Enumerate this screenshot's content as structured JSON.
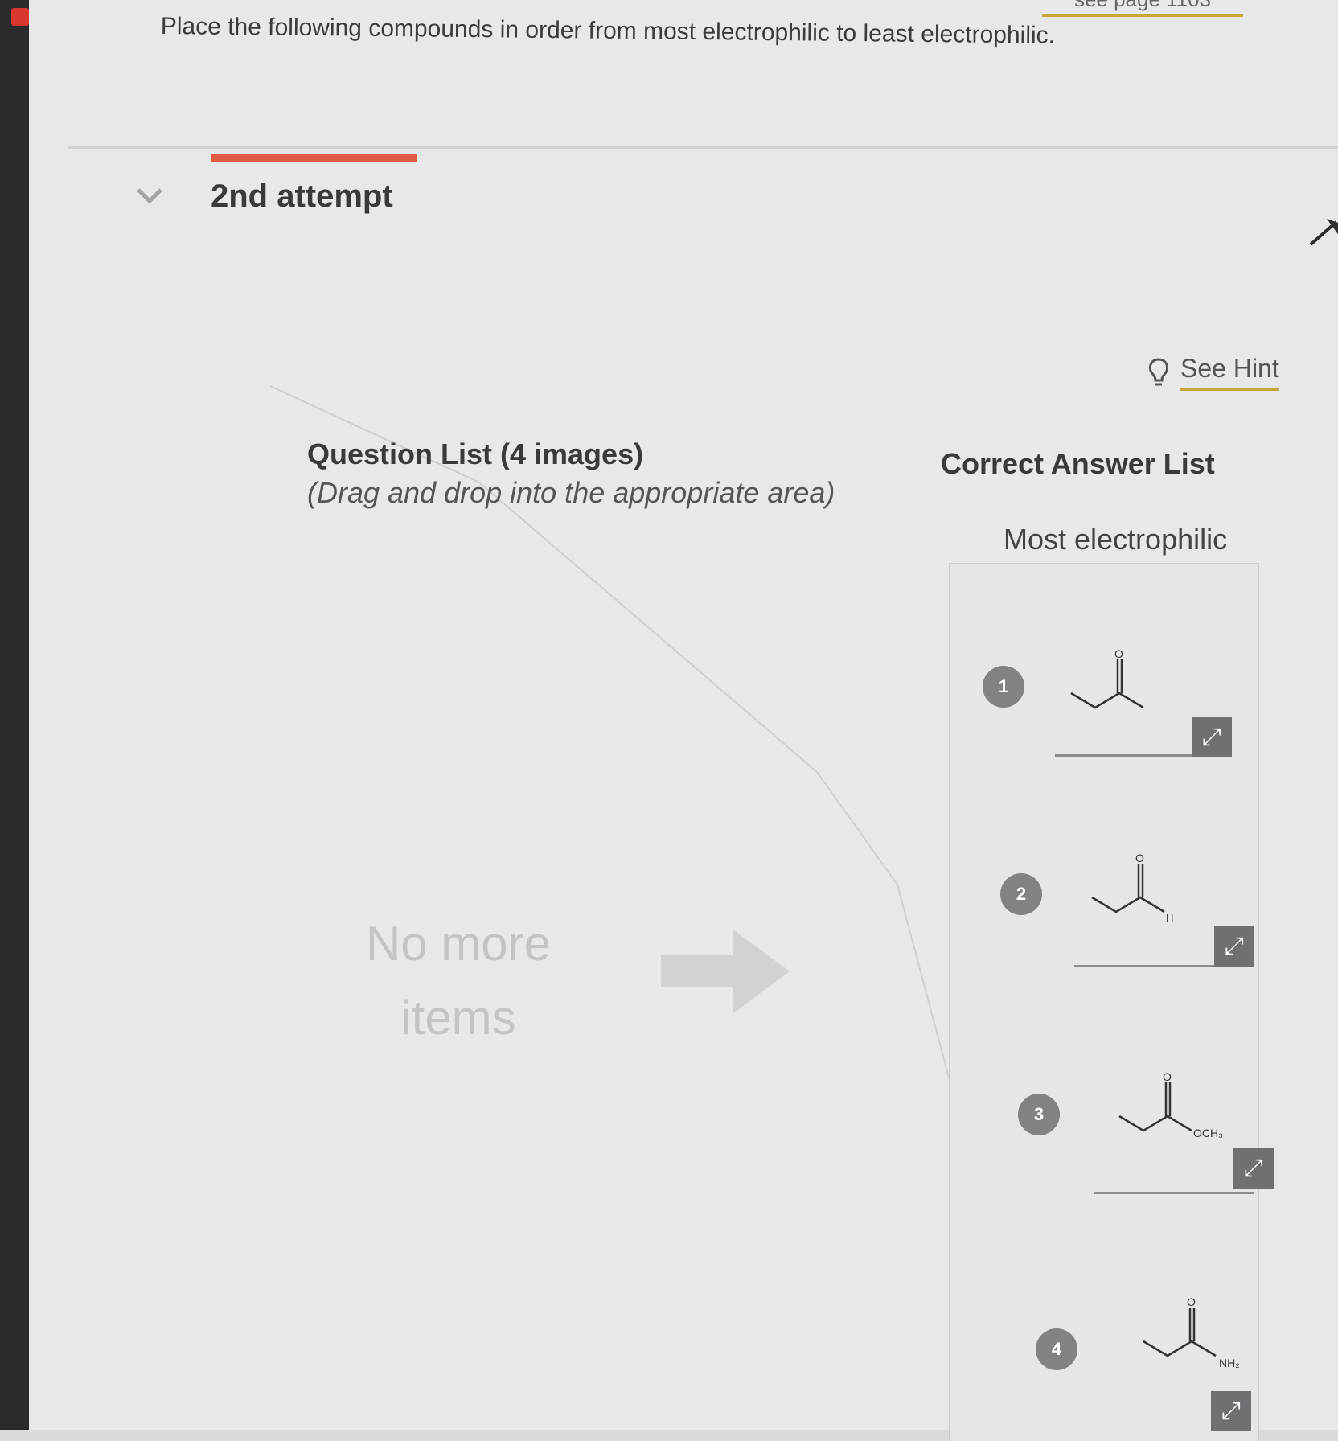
{
  "header": {
    "top_link_partial": "see page 1103",
    "question": "Place the following compounds in order from most electrophilic to least electrophilic."
  },
  "attempt": {
    "title": "2nd attempt"
  },
  "hint": {
    "label": "See Hint"
  },
  "question_list": {
    "title": "Question List (4 images)",
    "subtitle": "(Drag and drop into the appropriate area)",
    "empty_line1": "No more",
    "empty_line2": "items"
  },
  "answer_list": {
    "title": "Correct Answer List",
    "top_label": "Most electrophilic",
    "items": [
      {
        "number": "1",
        "oxygen_label": "O",
        "substituent_label": ""
      },
      {
        "number": "2",
        "oxygen_label": "O",
        "substituent_label": "H"
      },
      {
        "number": "3",
        "oxygen_label": "O",
        "substituent_label": "OCH₃"
      },
      {
        "number": "4",
        "oxygen_label": "O",
        "substituent_label": "NH₂"
      }
    ]
  },
  "colors": {
    "accent_red": "#e05b45",
    "hint_underline": "#c7a63a",
    "badge_gray": "#7f8386"
  },
  "icons": [
    "chevron-down-icon",
    "collapse-arrow-icon",
    "lightbulb-icon",
    "expand-icon",
    "drop-arrow-icon"
  ]
}
